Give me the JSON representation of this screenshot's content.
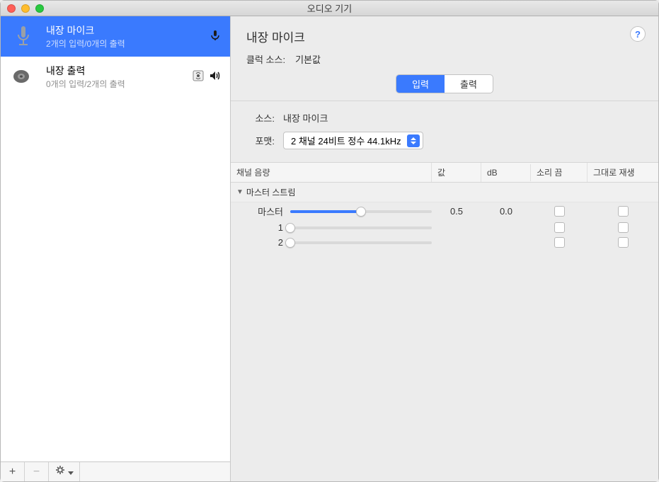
{
  "window": {
    "title": "오디오 기기"
  },
  "sidebar": {
    "devices": [
      {
        "name": "내장 마이크",
        "sub": "2개의 입력/0개의 출력",
        "selected": true,
        "type": "mic"
      },
      {
        "name": "내장 출력",
        "sub": "0개의 입력/2개의 출력",
        "selected": false,
        "type": "speaker"
      }
    ],
    "tools": {
      "add": "+",
      "remove": "−",
      "gear": "✻▾"
    }
  },
  "detail": {
    "title": "내장 마이크",
    "help": "?",
    "clockLabel": "클럭 소스:",
    "clockValue": "기본값",
    "tabs": {
      "input": "입력",
      "output": "출력"
    },
    "sourceLabel": "소스:",
    "sourceValue": "내장 마이크",
    "formatLabel": "포맷:",
    "formatValue": "2 채널 24비트 정수 44.1kHz"
  },
  "table": {
    "headers": {
      "vol": "채널 음량",
      "val": "값",
      "db": "dB",
      "mute": "소리 끔",
      "thru": "그대로 재생"
    },
    "streamLabel": "마스터 스트림",
    "rows": [
      {
        "label": "마스터",
        "pos": 0.5,
        "value": "0.5",
        "db": "0.0",
        "mute": false,
        "thru": false,
        "hasValues": true
      },
      {
        "label": "1",
        "pos": 0.0,
        "value": "",
        "db": "",
        "mute": false,
        "thru": false,
        "hasValues": false
      },
      {
        "label": "2",
        "pos": 0.0,
        "value": "",
        "db": "",
        "mute": false,
        "thru": false,
        "hasValues": false
      }
    ]
  }
}
